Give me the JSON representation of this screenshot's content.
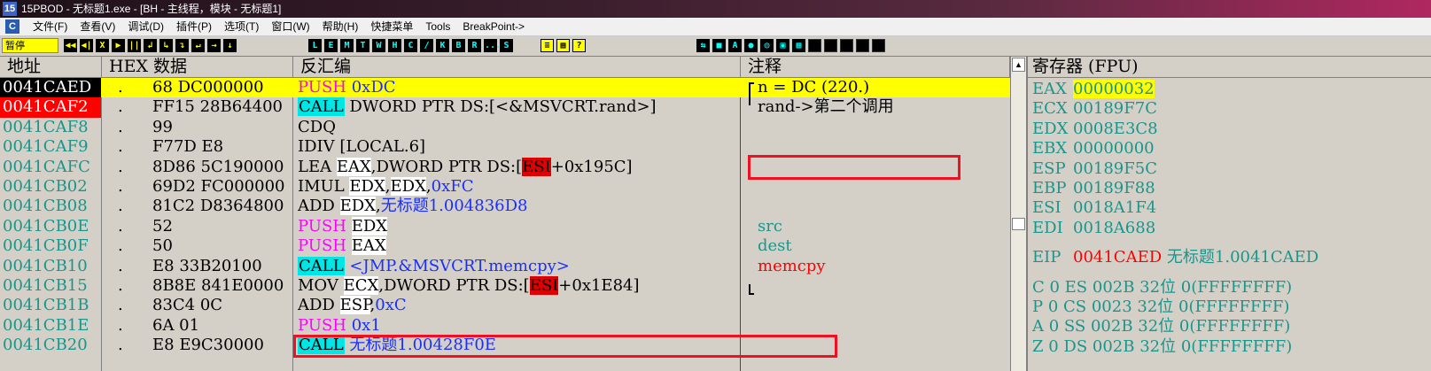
{
  "window": {
    "icon_text": "15",
    "title": "15PBOD  - 无标题1.exe - [BH - 主线程，模块 - 无标题1]"
  },
  "menu": {
    "icon_text": "C",
    "items": [
      "文件(F)",
      "查看(V)",
      "调试(D)",
      "插件(P)",
      "选项(T)",
      "窗口(W)",
      "帮助(H)",
      "快捷菜单",
      "Tools",
      "BreakPoint->"
    ]
  },
  "toolbar": {
    "status": "暂停",
    "nav_buttons": [
      "◀◀",
      "◀|",
      "X",
      "▶",
      "||",
      "↲",
      "↳",
      "↴",
      "↵",
      "→",
      "↓"
    ],
    "letter_buttons": [
      "L",
      "E",
      "M",
      "T",
      "W",
      "H",
      "C",
      "/",
      "K",
      "B",
      "R",
      "...",
      "S"
    ],
    "view_buttons": [
      "≡",
      "▦",
      "?"
    ],
    "plugin_buttons": [
      "⇆",
      "■",
      "A",
      "●",
      "◎",
      "▣",
      "▦",
      "",
      "",
      "",
      "",
      ""
    ]
  },
  "cpu": {
    "headers": {
      "addr": "地址",
      "hex": "HEX 数据",
      "disasm": "反汇编",
      "comment": "注释"
    },
    "rows": [
      {
        "addr": "0041CAED",
        "dot": ".",
        "hex": "68 DC000000",
        "mn": "PUSH",
        "mclass": "m-push",
        "ops": [
          {
            "t": "0xDC",
            "c": "op-blue"
          }
        ],
        "cmt": "n = DC (220.)",
        "cclass": "cmt-black"
      },
      {
        "addr": "0041CAF2",
        "dot": ".",
        "hex": "FF15 28B64400",
        "mn": "CALL",
        "mclass": "m-call",
        "ops": [
          {
            "t": "DWORD PTR DS:[<&MSVCRT.rand>]",
            "c": "op-black"
          }
        ],
        "cmt": "rand->第二个调用",
        "cclass": "cmt-black"
      },
      {
        "addr": "0041CAF8",
        "dot": ".",
        "hex": "99",
        "mn": "CDQ",
        "mclass": "m-norm",
        "ops": [],
        "cmt": "",
        "cclass": "cmt-black"
      },
      {
        "addr": "0041CAF9",
        "dot": ".",
        "hex": "F77D E8",
        "mn": "IDIV",
        "mclass": "m-norm",
        "ops": [
          {
            "t": "[LOCAL.6]",
            "c": "op-black"
          }
        ],
        "cmt": "",
        "cclass": "cmt-black"
      },
      {
        "addr": "0041CAFC",
        "dot": ".",
        "hex": "8D86 5C190000",
        "mn": "LEA",
        "mclass": "m-norm",
        "ops": [
          {
            "t": "EAX",
            "c": "op-w"
          },
          {
            "t": ",DWORD PTR DS:[",
            "c": "op-black"
          },
          {
            "t": "ESI",
            "c": "op-esi"
          },
          {
            "t": "+0x195C]",
            "c": "op-black"
          }
        ],
        "cmt": "",
        "cclass": "cmt-black"
      },
      {
        "addr": "0041CB02",
        "dot": ".",
        "hex": "69D2 FC000000",
        "mn": "IMUL",
        "mclass": "m-norm",
        "ops": [
          {
            "t": "EDX",
            "c": "op-w"
          },
          {
            "t": ",",
            "c": "op-black"
          },
          {
            "t": "EDX",
            "c": "op-w"
          },
          {
            "t": ",",
            "c": "op-black"
          },
          {
            "t": "0xFC",
            "c": "op-blue"
          }
        ],
        "cmt": "",
        "cclass": "cmt-black"
      },
      {
        "addr": "0041CB08",
        "dot": ".",
        "hex": "81C2 D8364800",
        "mn": "ADD",
        "mclass": "m-norm",
        "ops": [
          {
            "t": "EDX",
            "c": "op-w"
          },
          {
            "t": ",",
            "c": "op-black"
          },
          {
            "t": "无标题1.004836D8",
            "c": "op-blue"
          }
        ],
        "cmt": "",
        "cclass": "cmt-black"
      },
      {
        "addr": "0041CB0E",
        "dot": ".",
        "hex": "52",
        "mn": "PUSH",
        "mclass": "m-push",
        "ops": [
          {
            "t": "EDX",
            "c": "op-w"
          }
        ],
        "cmt": "src",
        "cclass": "cmt-blue"
      },
      {
        "addr": "0041CB0F",
        "dot": ".",
        "hex": "50",
        "mn": "PUSH",
        "mclass": "m-push",
        "ops": [
          {
            "t": "EAX",
            "c": "op-w"
          }
        ],
        "cmt": "dest",
        "cclass": "cmt-blue"
      },
      {
        "addr": "0041CB10",
        "dot": ".",
        "hex": "E8 33B20100",
        "mn": "CALL",
        "mclass": "m-call",
        "ops": [
          {
            "t": "<JMP.&MSVCRT.memcpy>",
            "c": "op-blue"
          }
        ],
        "cmt": "memcpy",
        "cclass": "cmt-red"
      },
      {
        "addr": "0041CB15",
        "dot": ".",
        "hex": "8B8E 841E0000",
        "mn": "MOV",
        "mclass": "m-norm",
        "ops": [
          {
            "t": "ECX",
            "c": "op-w"
          },
          {
            "t": ",DWORD PTR DS:[",
            "c": "op-black"
          },
          {
            "t": "ESI",
            "c": "op-esi"
          },
          {
            "t": "+0x1E84]",
            "c": "op-black"
          }
        ],
        "cmt": "",
        "cclass": "cmt-black"
      },
      {
        "addr": "0041CB1B",
        "dot": ".",
        "hex": "83C4 0C",
        "mn": "ADD",
        "mclass": "m-norm",
        "ops": [
          {
            "t": "ESP",
            "c": "op-w"
          },
          {
            "t": ",",
            "c": "op-black"
          },
          {
            "t": "0xC",
            "c": "op-blue"
          }
        ],
        "cmt": "",
        "cclass": "cmt-black"
      },
      {
        "addr": "0041CB1E",
        "dot": ".",
        "hex": "6A 01",
        "mn": "PUSH",
        "mclass": "m-push",
        "ops": [
          {
            "t": "0x1",
            "c": "op-blue"
          }
        ],
        "cmt": "",
        "cclass": "cmt-black"
      },
      {
        "addr": "0041CB20",
        "dot": ".",
        "hex": "E8 E9C30000",
        "mn": "CALL",
        "mclass": "m-call",
        "ops": [
          {
            "t": "无标题1.00428F0E",
            "c": "op-blue"
          }
        ],
        "cmt": "",
        "cclass": "cmt-black"
      }
    ]
  },
  "registers": {
    "header": "寄存器 (FPU)",
    "gp": [
      {
        "name": "EAX",
        "value": "00000032",
        "highlight": true
      },
      {
        "name": "ECX",
        "value": "00189F7C",
        "highlight": false
      },
      {
        "name": "EDX",
        "value": "0008E3C8",
        "highlight": false
      },
      {
        "name": "EBX",
        "value": "00000000",
        "highlight": false
      },
      {
        "name": "ESP",
        "value": "00189F5C",
        "highlight": false
      },
      {
        "name": "EBP",
        "value": "00189F88",
        "highlight": false
      },
      {
        "name": "ESI",
        "value": "0018A1F4",
        "highlight": false
      },
      {
        "name": "EDI",
        "value": "0018A688",
        "highlight": false
      }
    ],
    "eip": {
      "name": "EIP",
      "value": "0041CAED",
      "symbol": "无标题1.0041CAED"
    },
    "flags": [
      "C 0  ES 002B 32位 0(FFFFFFFF)",
      "P 0  CS 0023 32位 0(FFFFFFFF)",
      "A 0  SS 002B 32位 0(FFFFFFFF)",
      "Z 0  DS 002B 32位 0(FFFFFFFF)"
    ]
  }
}
